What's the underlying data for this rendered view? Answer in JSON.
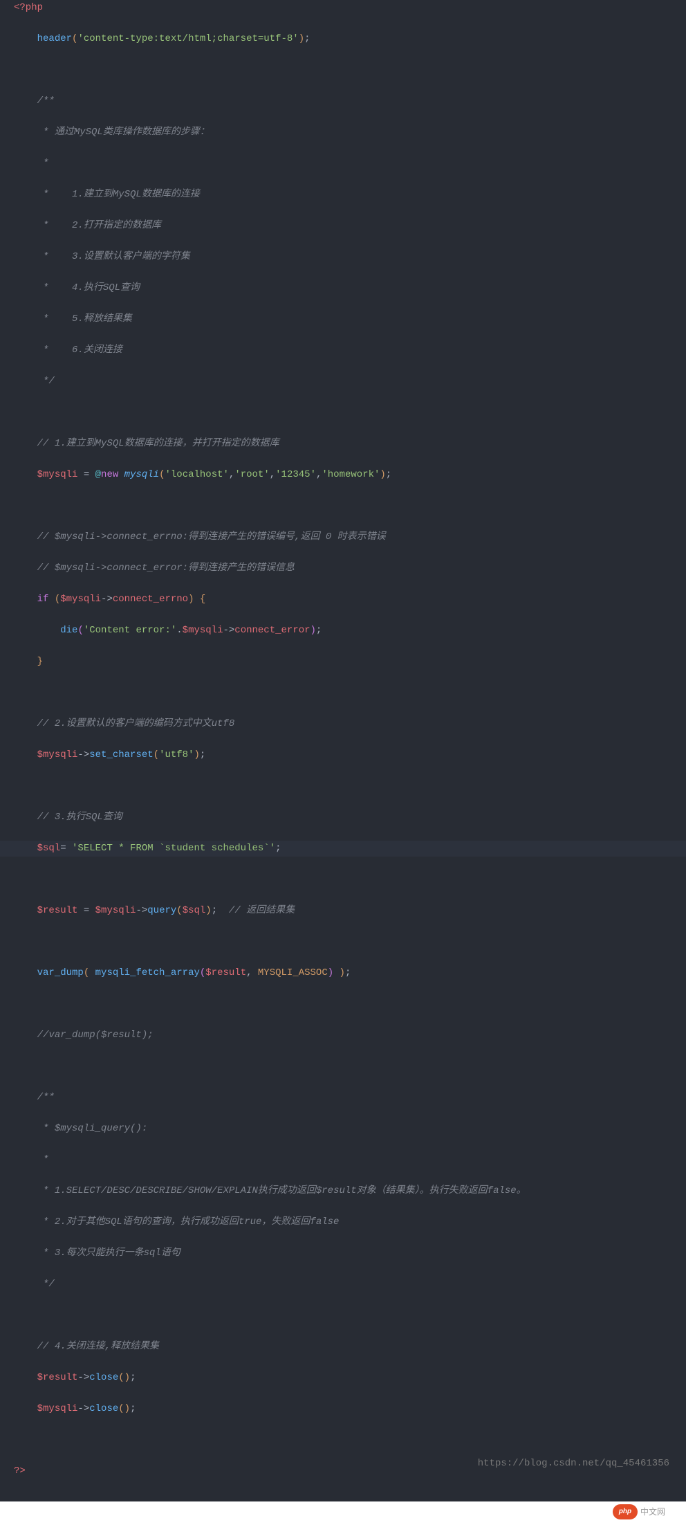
{
  "code": {
    "open_tag": "<?php",
    "close_tag": "?>",
    "header_fn": "header",
    "header_arg": "'content-type:text/html;charset=utf-8'",
    "doc1": {
      "l1": "/**",
      "l2": " * 通过MySQL类库操作数据库的步骤：",
      "l3": " * ",
      "l4": " *    1.建立到MySQL数据库的连接",
      "l5": " *    2.打开指定的数据库",
      "l6": " *    3.设置默认客户端的字符集",
      "l7": " *    4.执行SQL查询",
      "l8": " *    5.释放结果集",
      "l9": " *    6.关闭连接",
      "l10": " */"
    },
    "c_connect": "// 1.建立到MySQL数据库的连接，并打开指定的数据库",
    "var_mysqli": "$mysqli",
    "eq": " = ",
    "at": "@",
    "new": "new",
    "mysqli_class": "mysqli",
    "conn_args": {
      "host": "'localhost'",
      "user": "'root'",
      "pass": "'12345'",
      "db": "'homework'"
    },
    "c_errno": "// $mysqli->connect_errno:得到连接产生的错误编号,返回 0 时表示错误",
    "c_error": "// $mysqli->connect_error:得到连接产生的错误信息",
    "if_kw": "if",
    "connect_errno": "connect_errno",
    "die_fn": "die",
    "die_str": "'Content error:'",
    "connect_error": "connect_error",
    "c_charset": "// 2.设置默认的客户端的编码方式中文utf8",
    "set_charset_fn": "set_charset",
    "utf8_str": "'utf8'",
    "c_sql": "// 3.执行SQL查询",
    "var_sql": "$sql",
    "sql_str": "'SELECT * FROM `student schedules`'",
    "var_result": "$result",
    "query_fn": "query",
    "c_result": "// 返回结果集",
    "var_dump_fn": "var_dump",
    "fetch_fn": "mysqli_fetch_array",
    "assoc_const": "MYSQLI_ASSOC",
    "c_vardump": "//var_dump($result);",
    "doc2": {
      "l1": "/**",
      "l2": " * $mysqli_query():",
      "l3": " * ",
      "l4": " * 1.SELECT/DESC/DESCRIBE/SHOW/EXPLAIN执行成功返回$result对象（结果集）。执行失败返回false。",
      "l5": " * 2.对于其他SQL语句的查询，执行成功返回true，失败返回false",
      "l6": " * 3.每次只能执行一条sql语句",
      "l7": " */"
    },
    "c_close": "// 4.关闭连接,释放结果集",
    "close_fn": "close"
  },
  "footer": {
    "blog_url": "https://blog.csdn.net/qq_45461356",
    "badge": "php",
    "site": "中文网"
  }
}
